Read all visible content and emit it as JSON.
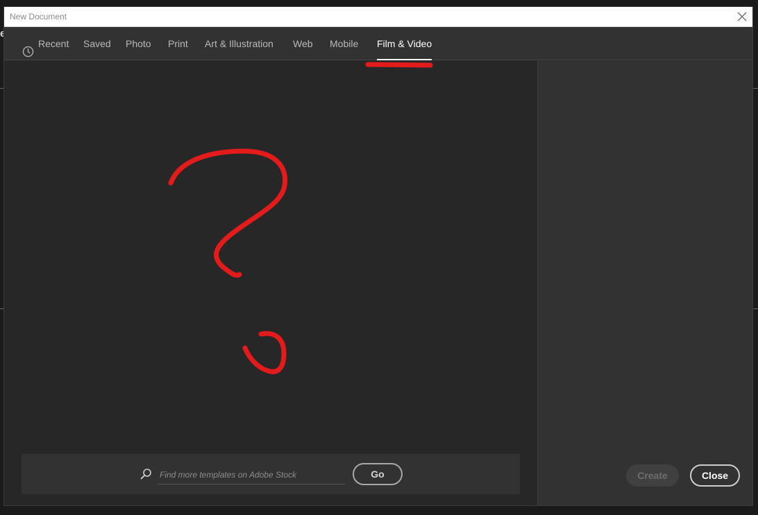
{
  "window": {
    "title": "New Document"
  },
  "tabs": [
    {
      "label": "Recent",
      "icon": "clock-icon"
    },
    {
      "label": "Saved"
    },
    {
      "label": "Photo"
    },
    {
      "label": "Print"
    },
    {
      "label": "Art & Illustration"
    },
    {
      "label": "Web"
    },
    {
      "label": "Mobile"
    },
    {
      "label": "Film & Video",
      "active": true
    }
  ],
  "search": {
    "placeholder": "Find more templates on Adobe Stock",
    "value": "",
    "go_label": "Go"
  },
  "actions": {
    "create_label": "Create",
    "close_label": "Close"
  },
  "background": {
    "partial_glyph": "e"
  },
  "colors": {
    "annotation": "#e31b1b",
    "active_tab": "#ffffff",
    "panel": "#272727",
    "sidebar": "#323232"
  }
}
